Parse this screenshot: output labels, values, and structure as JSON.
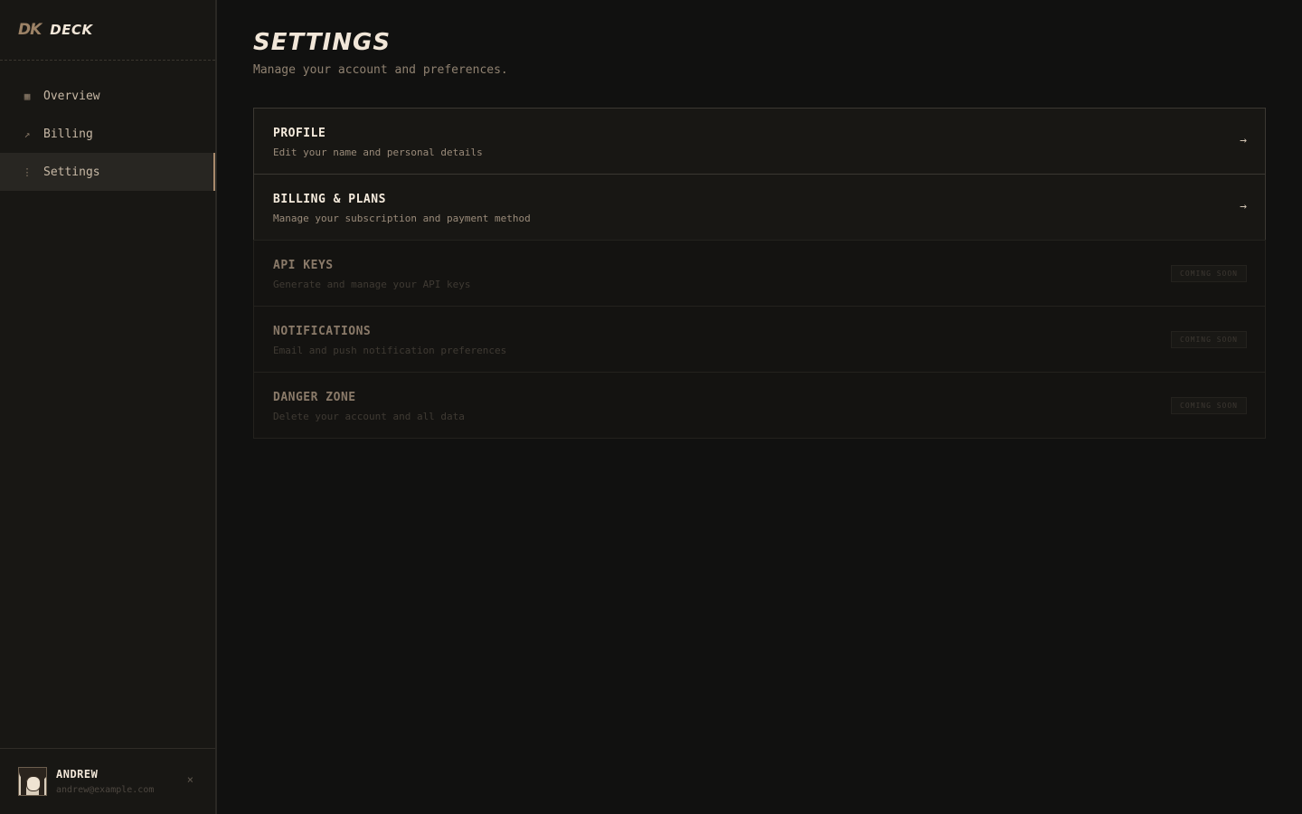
{
  "brand": {
    "mark": "DK",
    "name": "DECK"
  },
  "sidebar": {
    "items": [
      {
        "icon": "chart-icon",
        "glyph": "▦",
        "label": "Overview",
        "active": false
      },
      {
        "icon": "trend-arrow-icon",
        "glyph": "↗",
        "label": "Billing",
        "active": false
      },
      {
        "icon": "dots-vertical-icon",
        "glyph": "⋮",
        "label": "Settings",
        "active": true
      }
    ]
  },
  "user": {
    "name": "ANDREW",
    "email": "andrew@example.com",
    "close_glyph": "×"
  },
  "page": {
    "title": "SETTINGS",
    "subtitle": "Manage your account and preferences."
  },
  "cards": [
    {
      "title": "PROFILE",
      "description": "Edit your name and personal details",
      "status": "enabled",
      "arrow": "→"
    },
    {
      "title": "BILLING & PLANS",
      "description": "Manage your subscription and payment method",
      "status": "enabled",
      "arrow": "→"
    },
    {
      "title": "API KEYS",
      "description": "Generate and manage your API keys",
      "status": "disabled",
      "badge": "COMING SOON"
    },
    {
      "title": "NOTIFICATIONS",
      "description": "Email and push notification preferences",
      "status": "disabled",
      "badge": "COMING SOON"
    },
    {
      "title": "DANGER ZONE",
      "description": "Delete your account and all data",
      "status": "disabled",
      "badge": "COMING SOON"
    }
  ],
  "colors": {
    "background": "#111110",
    "sidebar": "#181714",
    "accent": "#a88a6c",
    "text": "#f1e6d8"
  }
}
